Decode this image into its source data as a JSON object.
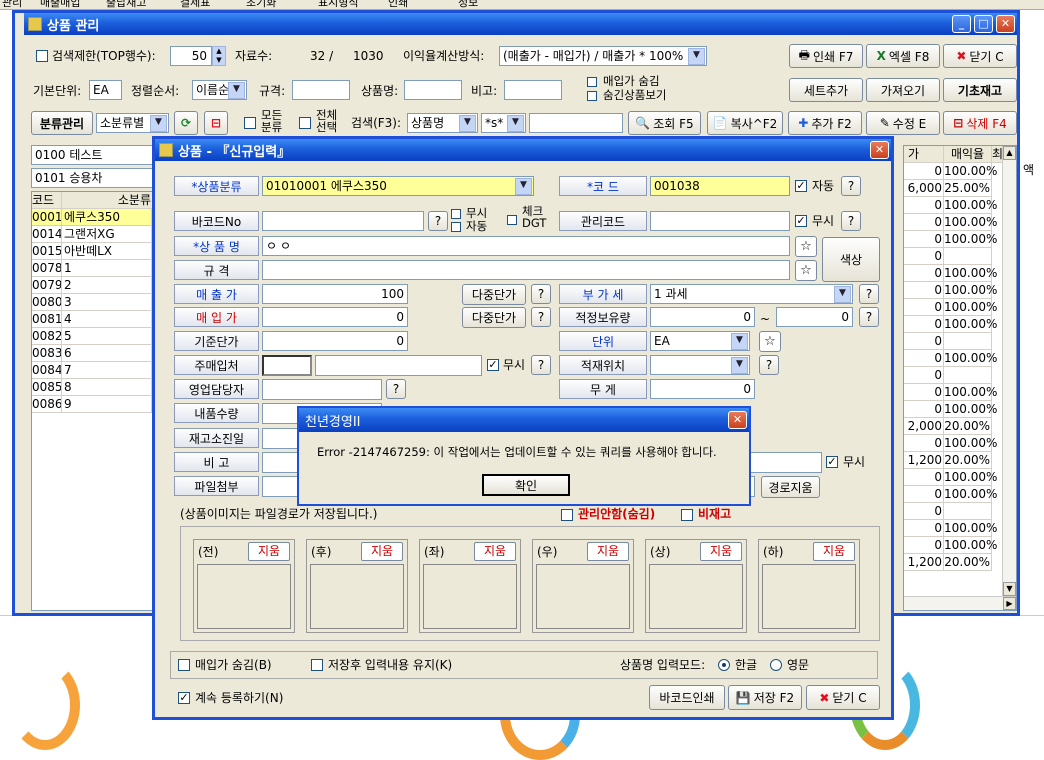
{
  "top_menu": {
    "items": [
      "관리",
      "매출매입",
      "출납재고",
      "결제표",
      "초기화",
      "표시형식",
      "인쇄",
      "환경설정",
      "정보"
    ]
  },
  "main_window": {
    "title": "상품 관리",
    "toolbar1": {
      "search_limit_label": "검색제한(TOP행수):",
      "search_limit_value": "50",
      "record_label": "자료수:",
      "record_count": "32 /",
      "record_total": "1030",
      "profit_method_label": "이익율계산방식:",
      "profit_method_value": "(매출가 - 매입가) / 매출가 * 100%",
      "print_btn": "인쇄 F7",
      "excel_btn": "엑셀 F8",
      "close_btn": "닫기 C"
    },
    "toolbar2": {
      "base_unit_label": "기본단위:",
      "base_unit_value": "EA",
      "sort_label": "정렬순서:",
      "sort_value": "이름순",
      "spec_label": "규격:",
      "product_name_label": "상품명:",
      "note_label": "비고:",
      "hide_purchase_price": "매입가 숨김",
      "show_hidden_items": "숨긴상품보기",
      "set_add_btn": "세트추가",
      "import_btn": "가져오기",
      "base_stock_btn": "기초재고"
    },
    "toolbar3": {
      "category_mgmt_btn": "분류관리",
      "subcategory_value": "소분류별",
      "all_category_label": "모든분류",
      "select_all_label": "전체선택",
      "search_label": "검색(F3):",
      "search_field_value": "상품명",
      "search_pattern_value": "*s*",
      "view_btn": "조회 F5",
      "copy_btn": "복사^F2",
      "add_btn": "추가 F2",
      "edit_btn": "수정 E",
      "delete_btn": "삭제 F4"
    },
    "category_fields": [
      "0100 테스트",
      "0101 승용차"
    ],
    "grid": {
      "headers": [
        "코드",
        "소분류"
      ],
      "rows": [
        {
          "code": "0001",
          "name": "에쿠스350"
        },
        {
          "code": "0014",
          "name": "그랜저XG"
        },
        {
          "code": "0015",
          "name": "아반떼LX"
        },
        {
          "code": "0078",
          "name": "1"
        },
        {
          "code": "0079",
          "name": "2"
        },
        {
          "code": "0080",
          "name": "3"
        },
        {
          "code": "0081",
          "name": "4"
        },
        {
          "code": "0082",
          "name": "5"
        },
        {
          "code": "0083",
          "name": "6"
        },
        {
          "code": "0084",
          "name": "7"
        },
        {
          "code": "0085",
          "name": "8"
        },
        {
          "code": "0086",
          "name": "9"
        }
      ]
    },
    "right_grid": {
      "headers": [
        "가",
        "매익율",
        "최"
      ],
      "rows": [
        {
          "a": "0",
          "b": "100.00%"
        },
        {
          "a": "6,000",
          "b": "25.00%"
        },
        {
          "a": "0",
          "b": "100.00%"
        },
        {
          "a": "0",
          "b": "100.00%"
        },
        {
          "a": "0",
          "b": "100.00%"
        },
        {
          "a": "0",
          "b": ""
        },
        {
          "a": "0",
          "b": "100.00%"
        },
        {
          "a": "0",
          "b": "100.00%"
        },
        {
          "a": "0",
          "b": "100.00%"
        },
        {
          "a": "0",
          "b": "100.00%"
        },
        {
          "a": "0",
          "b": ""
        },
        {
          "a": "0",
          "b": "100.00%"
        },
        {
          "a": "0",
          "b": ""
        },
        {
          "a": "0",
          "b": "100.00%"
        },
        {
          "a": "0",
          "b": "100.00%"
        },
        {
          "a": "2,000",
          "b": "20.00%"
        },
        {
          "a": "0",
          "b": "100.00%"
        },
        {
          "a": "1,200",
          "b": "20.00%"
        },
        {
          "a": "0",
          "b": "100.00%"
        },
        {
          "a": "0",
          "b": "100.00%"
        },
        {
          "a": "0",
          "b": ""
        },
        {
          "a": "0",
          "b": "100.00%"
        },
        {
          "a": "0",
          "b": "100.00%"
        },
        {
          "a": "1,200",
          "b": "20.00%"
        }
      ],
      "side_label": "액"
    }
  },
  "dialog": {
    "title": "상품 - 『신규입력』",
    "labels": {
      "category": "*상품분류",
      "code": "*코   드",
      "barcode": "바코드No",
      "manage_code": "관리코드",
      "name": "*상 품 명",
      "spec": "규    격",
      "sale_price": "매 출 가",
      "purchase_price": "매 입 가",
      "base_price": "기준단가",
      "main_supplier": "주매입처",
      "sales_staff": "영업담당자",
      "delivery_qty": "내품수량",
      "stock_alert": "재고소진일",
      "note": "비    고",
      "file_attach": "파일첨부",
      "vat": "부 가 세",
      "optimal_stock": "적정보유량",
      "unit": "단위",
      "storage": "적재위치",
      "weight": "무    게"
    },
    "values": {
      "category": "01010001 에쿠스350",
      "code": "001038",
      "name": "ㅇㅇ",
      "sale_price": "100",
      "purchase_price": "0",
      "base_price": "0",
      "vat": "1 과세",
      "optimal_min": "0",
      "optimal_max": "0",
      "unit": "EA",
      "weight": "0"
    },
    "auto_label": "자동",
    "ignore_label": "무시",
    "nohide_label": "무시",
    "nohide_auto_label": "자동",
    "check_digit_label": "체크DGT",
    "multi_price_btn": "다중단가",
    "color_btn": "색상",
    "tilde": "~",
    "path_clear_btn": "경로지움",
    "image_note": "(상품이미지는 파일경로가 저장됩니다.)",
    "manage_hide": "관리안함(숨김)",
    "not_used": "비재고",
    "image_slots": [
      "(전)",
      "(후)",
      "(좌)",
      "(우)",
      "(상)",
      "(하)"
    ],
    "image_delete": "지움",
    "hide_purchase": "매입가 숨김(B)",
    "keep_input": "저장후 입력내용 유지(K)",
    "input_mode_label": "상품명 입력모드:",
    "mode_korean": "한글",
    "mode_english": "영문",
    "continue_register": "계속 등록하기(N)",
    "barcode_print_btn": "바코드인쇄",
    "save_btn": "저장 F2",
    "close_btn": "닫기 C"
  },
  "alert": {
    "title": "천년경영II",
    "message": "Error -2147467259: 이 작업에서는 업데이트할 수 있는 쿼리를 사용해야 합니다.",
    "ok_btn": "확인"
  }
}
